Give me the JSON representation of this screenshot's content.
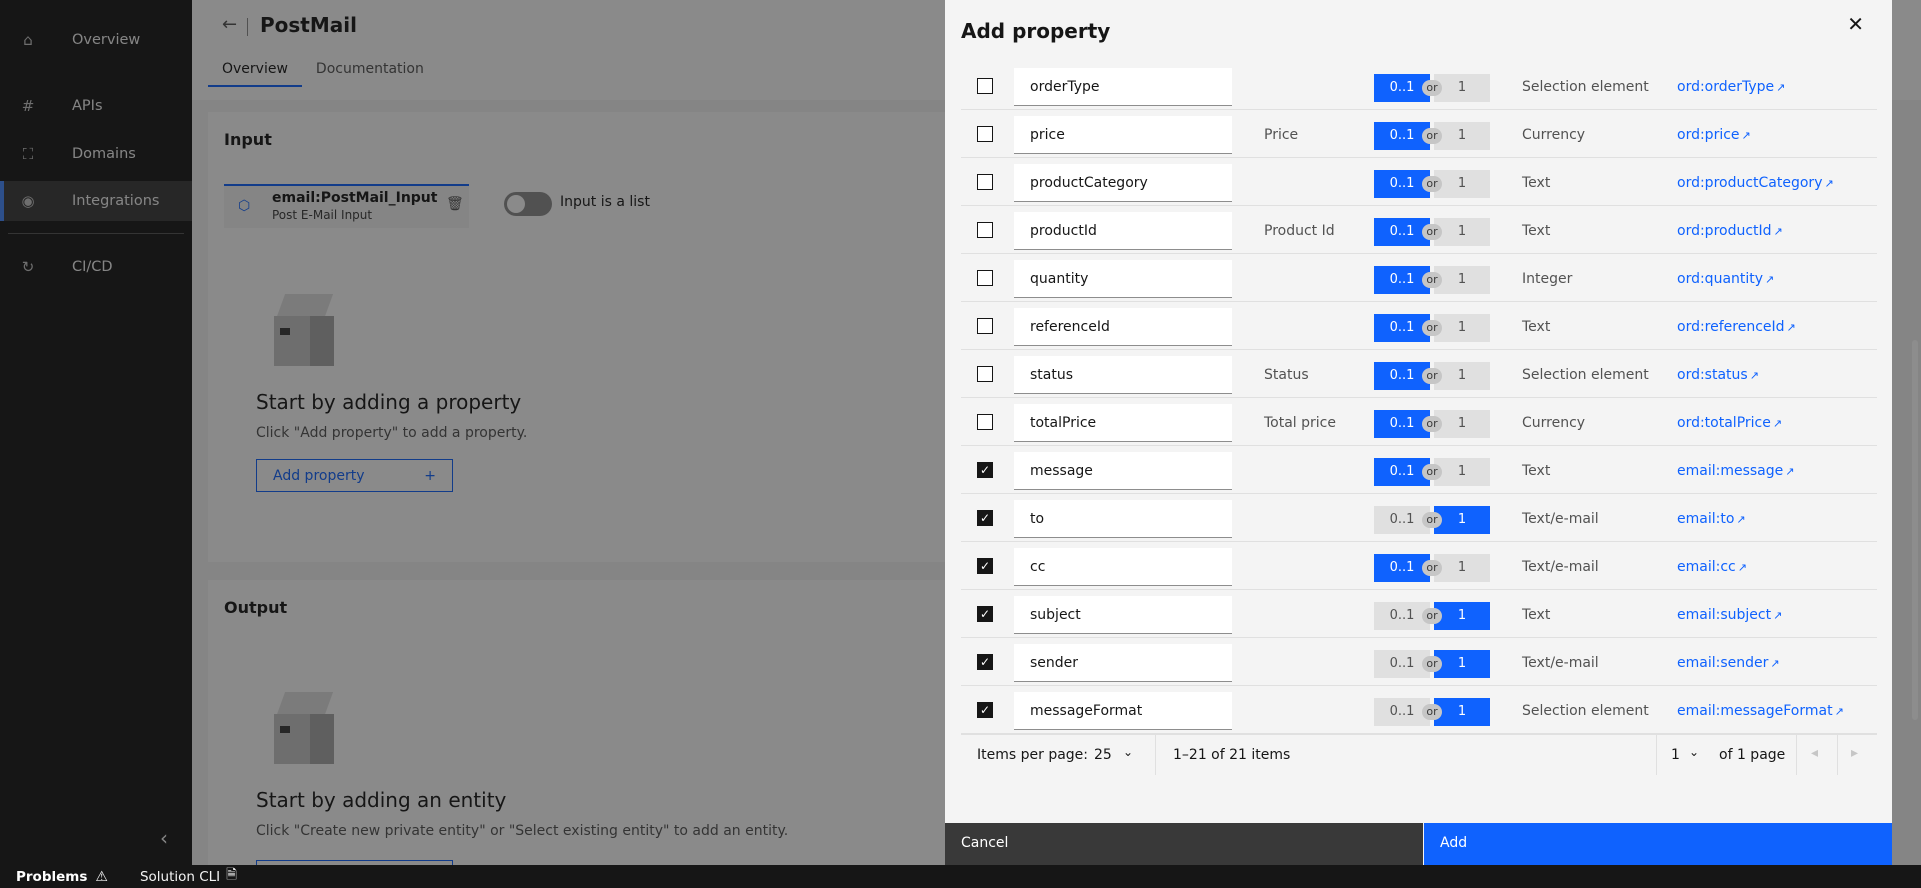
{
  "sidebar": {
    "items": [
      {
        "label": "Overview",
        "icon": "home-icon"
      },
      {
        "label": "APIs",
        "icon": "hash-icon"
      },
      {
        "label": "Domains",
        "icon": "domains-icon"
      },
      {
        "label": "Integrations",
        "icon": "integrations-icon"
      },
      {
        "label": "CI/CD",
        "icon": "cicd-icon"
      }
    ]
  },
  "header": {
    "title": "PostMail",
    "tabs": [
      "Overview",
      "Documentation"
    ]
  },
  "input_card": {
    "title": "Input",
    "entity_name": "email:PostMail_Input",
    "entity_sub": "Post E-Mail Input",
    "toggle_label": "Input is a list",
    "empty_title": "Start by adding a property",
    "empty_text": "Click \"Add property\" to add a property.",
    "add_button": "Add property"
  },
  "output_card": {
    "title": "Output",
    "empty_title": "Start by adding an entity",
    "empty_text": "Click \"Create new private entity\" or \"Select existing entity\" to add an entity."
  },
  "statusbar": {
    "problems": "Problems",
    "cli": "Solution CLI"
  },
  "modal": {
    "title": "Add property",
    "cardinality_a": "0..1",
    "cardinality_or": "or",
    "cardinality_b": "1",
    "rows": [
      {
        "name": "orderType",
        "label": "",
        "card": "a",
        "type": "Selection element",
        "link": "ord:orderType",
        "checked": false
      },
      {
        "name": "price",
        "label": "Price",
        "card": "a",
        "type": "Currency",
        "link": "ord:price",
        "checked": false
      },
      {
        "name": "productCategory",
        "label": "",
        "card": "a",
        "type": "Text",
        "link": "ord:productCategory",
        "checked": false
      },
      {
        "name": "productId",
        "label": "Product Id",
        "card": "a",
        "type": "Text",
        "link": "ord:productId",
        "checked": false
      },
      {
        "name": "quantity",
        "label": "",
        "card": "a",
        "type": "Integer",
        "link": "ord:quantity",
        "checked": false
      },
      {
        "name": "referenceId",
        "label": "",
        "card": "a",
        "type": "Text",
        "link": "ord:referenceId",
        "checked": false
      },
      {
        "name": "status",
        "label": "Status",
        "card": "a",
        "type": "Selection element",
        "link": "ord:status",
        "checked": false
      },
      {
        "name": "totalPrice",
        "label": "Total price",
        "card": "a",
        "type": "Currency",
        "link": "ord:totalPrice",
        "checked": false
      },
      {
        "name": "message",
        "label": "",
        "card": "a",
        "type": "Text",
        "link": "email:message",
        "checked": true
      },
      {
        "name": "to",
        "label": "",
        "card": "b",
        "type": "Text/e-mail",
        "link": "email:to",
        "checked": true
      },
      {
        "name": "cc",
        "label": "",
        "card": "a",
        "type": "Text/e-mail",
        "link": "email:cc",
        "checked": true
      },
      {
        "name": "subject",
        "label": "",
        "card": "b",
        "type": "Text",
        "link": "email:subject",
        "checked": true
      },
      {
        "name": "sender",
        "label": "",
        "card": "b",
        "type": "Text/e-mail",
        "link": "email:sender",
        "checked": true
      },
      {
        "name": "messageFormat",
        "label": "",
        "card": "b",
        "type": "Selection element",
        "link": "email:messageFormat",
        "checked": true
      }
    ],
    "pagination": {
      "items_per_page_label": "Items per page:",
      "items_per_page": "25",
      "range": "1–21 of 21 items",
      "page": "1",
      "of_pages": "of 1 page"
    },
    "cancel": "Cancel",
    "add": "Add"
  },
  "colors": {
    "accent": "#0f62fe",
    "sidebar_bg": "#161616"
  }
}
